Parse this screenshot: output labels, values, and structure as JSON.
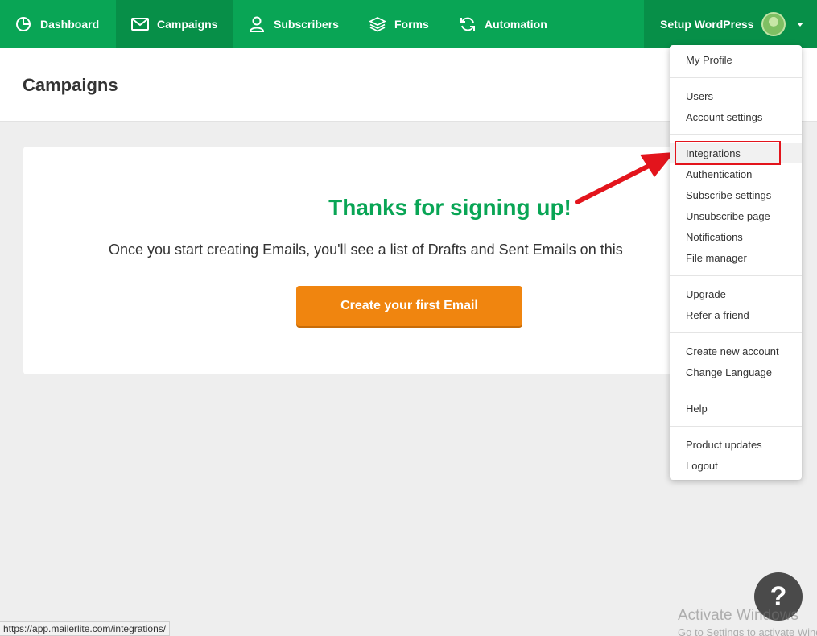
{
  "nav": {
    "items": [
      {
        "label": "Dashboard",
        "icon": "clock-icon"
      },
      {
        "label": "Campaigns",
        "icon": "envelope-icon"
      },
      {
        "label": "Subscribers",
        "icon": "user-icon"
      },
      {
        "label": "Forms",
        "icon": "layers-icon"
      },
      {
        "label": "Automation",
        "icon": "refresh-icon"
      }
    ],
    "active": "Campaigns",
    "account_name": "Setup WordPress"
  },
  "header": {
    "title": "Campaigns"
  },
  "card": {
    "title": "Thanks for signing up!",
    "text": "Once you start creating Emails, you'll see a list of Drafts and Sent Emails on this",
    "button_label": "Create your first Email"
  },
  "dropdown": {
    "groups": [
      [
        "My Profile"
      ],
      [
        "Users",
        "Account settings"
      ],
      [
        "Integrations",
        "Authentication",
        "Subscribe settings",
        "Unsubscribe page",
        "Notifications",
        "File manager"
      ],
      [
        "Upgrade",
        "Refer a friend"
      ],
      [
        "Create new account",
        "Change Language"
      ],
      [
        "Help"
      ],
      [
        "Product updates",
        "Logout"
      ]
    ],
    "highlighted": "Integrations"
  },
  "help": {
    "label": "?"
  },
  "status_url": "https://app.mailerlite.com/integrations/",
  "watermark": {
    "line1": "Activate Windows",
    "line2": "Go to Settings to activate Windows."
  },
  "colors": {
    "nav_bg": "#09a555",
    "nav_active": "#078f48",
    "accent_orange": "#f0850f",
    "title_green": "#09a555",
    "highlight_red": "#e3141c"
  }
}
